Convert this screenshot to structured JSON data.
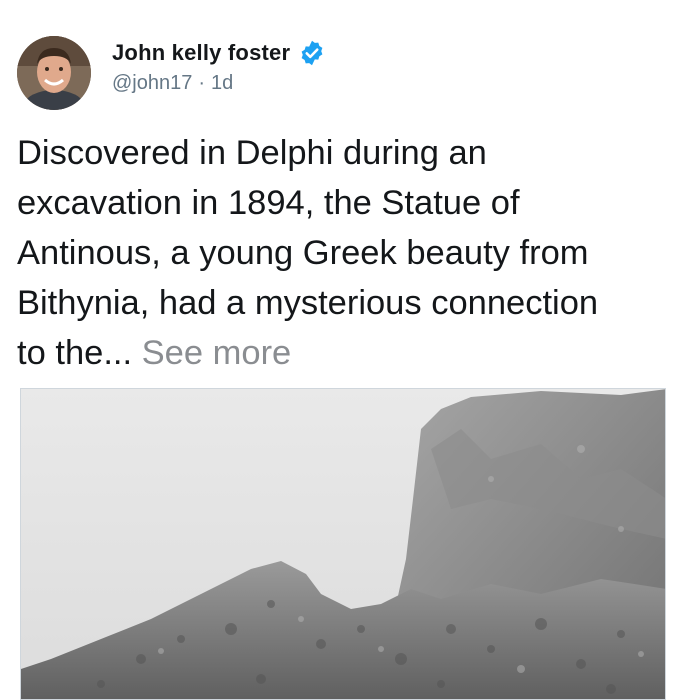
{
  "author": {
    "name": "John kelly foster",
    "handle": "@john17",
    "separator": "·",
    "time": "1d",
    "verified": true,
    "verified_color": "#1da1f2"
  },
  "tweet": {
    "lines": [
      "Discovered in Delphi during an",
      "excavation in 1894, the Statue of",
      "Antinous, a young Greek beauty from",
      "Bithynia, had a mysterious connection",
      "to the... "
    ],
    "see_more": "See more"
  },
  "media": {
    "icon": "photo",
    "style": "black-and-white"
  },
  "icons": {
    "verified": "verified-badge-icon",
    "avatar": "profile-avatar"
  }
}
